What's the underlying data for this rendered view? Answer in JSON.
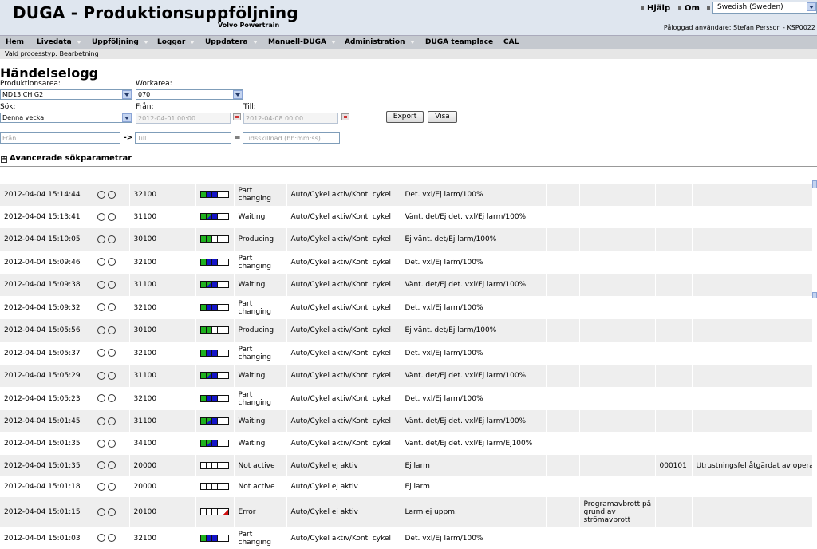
{
  "header": {
    "title": "DUGA - Produktionsuppföljning",
    "subtitle": "Volvo Powertrain",
    "help": "Hjälp",
    "about": "Om",
    "language": "Swedish (Sweden)",
    "user": "Påloggad användare: Stefan Persson - KSP0022"
  },
  "menu": [
    {
      "label": "Hem",
      "arrow": false
    },
    {
      "label": "Livedata",
      "arrow": true
    },
    {
      "label": "Uppföljning",
      "arrow": true
    },
    {
      "label": "Loggar",
      "arrow": true
    },
    {
      "label": "Uppdatera",
      "arrow": true
    },
    {
      "label": "Manuell-DUGA",
      "arrow": true
    },
    {
      "label": "Administration",
      "arrow": true
    },
    {
      "label": "DUGA teamplace",
      "arrow": false
    },
    {
      "label": "CAL",
      "arrow": false
    }
  ],
  "process_type": "Vald processtyp: Bearbetning",
  "page": {
    "title": "Händelselogg",
    "production_area_label": "Produktionsarea:",
    "production_area_value": "MD13 CH G2",
    "workarea_label": "Workarea:",
    "workarea_value": "070",
    "search_label": "Sök:",
    "search_value": "Denna vecka",
    "from_label": "Från:",
    "from_value": "2012-04-01 00:00",
    "to_label": "Till:",
    "to_value": "2012-04-08 00:00",
    "export_button": "Export",
    "show_button": "Visa",
    "range_from_placeholder": "Från",
    "range_arrow": "->",
    "range_to_placeholder": "Till",
    "equals": "=",
    "time_diff_placeholder": "Tidsskillnad (hh:mm:ss)",
    "advanced": "Avancerade sökparametrar",
    "advanced_icon": "≚"
  },
  "log_rows": [
    {
      "time": "2012-04-04 15:14:44",
      "code": "32100",
      "state": "gbbww",
      "status": "Part changing",
      "mode": "Auto/Cykel aktiv/Kont. cykel",
      "detail": "Det. vxl/Ej larm/100%",
      "extra": "",
      "num": "",
      "msg": ""
    },
    {
      "time": "2012-04-04 15:13:41",
      "code": "31100",
      "state": "gxbww",
      "status": "Waiting",
      "mode": "Auto/Cykel aktiv/Kont. cykel",
      "detail": "Vänt. det/Ej det. vxl/Ej larm/100%",
      "extra": "",
      "num": "",
      "msg": ""
    },
    {
      "time": "2012-04-04 15:10:05",
      "code": "30100",
      "state": "ggww w",
      "status": "Producing",
      "mode": "Auto/Cykel aktiv/Kont. cykel",
      "detail": "Ej vänt. det/Ej larm/100%",
      "extra": "",
      "num": "",
      "msg": ""
    },
    {
      "time": "2012-04-04 15:09:46",
      "code": "32100",
      "state": "gbbww",
      "status": "Part changing",
      "mode": "Auto/Cykel aktiv/Kont. cykel",
      "detail": "Det. vxl/Ej larm/100%",
      "extra": "",
      "num": "",
      "msg": ""
    },
    {
      "time": "2012-04-04 15:09:38",
      "code": "31100",
      "state": "gxbww",
      "status": "Waiting",
      "mode": "Auto/Cykel aktiv/Kont. cykel",
      "detail": "Vänt. det/Ej det. vxl/Ej larm/100%",
      "extra": "",
      "num": "",
      "msg": ""
    },
    {
      "time": "2012-04-04 15:09:32",
      "code": "32100",
      "state": "gbbww",
      "status": "Part changing",
      "mode": "Auto/Cykel aktiv/Kont. cykel",
      "detail": "Det. vxl/Ej larm/100%",
      "extra": "",
      "num": "",
      "msg": ""
    },
    {
      "time": "2012-04-04 15:05:56",
      "code": "30100",
      "state": "ggwww",
      "status": "Producing",
      "mode": "Auto/Cykel aktiv/Kont. cykel",
      "detail": "Ej vänt. det/Ej larm/100%",
      "extra": "",
      "num": "",
      "msg": ""
    },
    {
      "time": "2012-04-04 15:05:37",
      "code": "32100",
      "state": "gbbww",
      "status": "Part changing",
      "mode": "Auto/Cykel aktiv/Kont. cykel",
      "detail": "Det. vxl/Ej larm/100%",
      "extra": "",
      "num": "",
      "msg": ""
    },
    {
      "time": "2012-04-04 15:05:29",
      "code": "31100",
      "state": "gxbww",
      "status": "Waiting",
      "mode": "Auto/Cykel aktiv/Kont. cykel",
      "detail": "Vänt. det/Ej det. vxl/Ej larm/100%",
      "extra": "",
      "num": "",
      "msg": ""
    },
    {
      "time": "2012-04-04 15:05:23",
      "code": "32100",
      "state": "gbbww",
      "status": "Part changing",
      "mode": "Auto/Cykel aktiv/Kont. cykel",
      "detail": "Det. vxl/Ej larm/100%",
      "extra": "",
      "num": "",
      "msg": ""
    },
    {
      "time": "2012-04-04 15:01:45",
      "code": "31100",
      "state": "gxbww",
      "status": "Waiting",
      "mode": "Auto/Cykel aktiv/Kont. cykel",
      "detail": "Vänt. det/Ej det. vxl/Ej larm/100%",
      "extra": "",
      "num": "",
      "msg": ""
    },
    {
      "time": "2012-04-04 15:01:35",
      "code": "34100",
      "state": "gxbww",
      "status": "Waiting",
      "mode": "Auto/Cykel aktiv/Kont. cykel",
      "detail": "Vänt. det/Ej det. vxl/Ej larm/Ej100%",
      "extra": "",
      "num": "",
      "msg": ""
    },
    {
      "time": "2012-04-04 15:01:35",
      "code": "20000",
      "state": "wwwww",
      "status": "Not active",
      "mode": "Auto/Cykel ej aktiv",
      "detail": "Ej larm",
      "extra": "",
      "num": "000101",
      "msg": "Utrustningsfel åtgärdat av operatör"
    },
    {
      "time": "2012-04-04 15:01:18",
      "code": "20000",
      "state": "wwwww",
      "status": "Not active",
      "mode": "Auto/Cykel ej aktiv",
      "detail": "Ej larm",
      "extra": "",
      "num": "",
      "msg": ""
    },
    {
      "time": "2012-04-04 15:01:15",
      "code": "20100",
      "state": "wwwwr",
      "status": "Error",
      "mode": "Auto/Cykel ej aktiv",
      "detail": "Larm ej uppm.",
      "extra": "Programavbrott på grund av strömavbrott",
      "num": "",
      "msg": ""
    },
    {
      "time": "2012-04-04 15:01:03",
      "code": "32100",
      "state": "gbbww",
      "status": "Part changing",
      "mode": "Auto/Cykel aktiv/Kont. cykel",
      "detail": "Det. vxl/Ej larm/100%",
      "extra": "",
      "num": "",
      "msg": ""
    }
  ]
}
